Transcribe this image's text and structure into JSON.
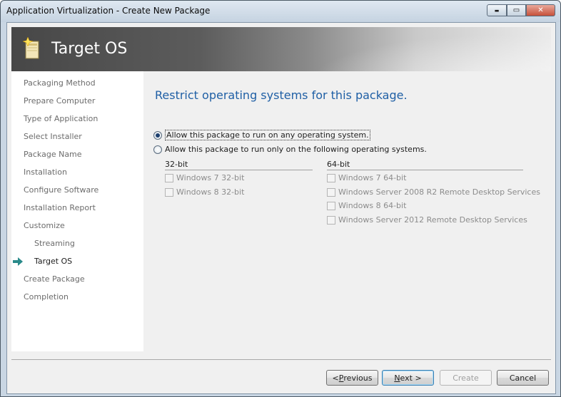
{
  "window": {
    "title": "Application Virtualization - Create New Package",
    "controls": {
      "minimize": "▬",
      "maximize": "▭",
      "close": "✕"
    }
  },
  "banner": {
    "title": "Target OS",
    "icon": "package-wizard-icon"
  },
  "nav": {
    "items": [
      {
        "label": "Packaging Method"
      },
      {
        "label": "Prepare Computer"
      },
      {
        "label": "Type of Application"
      },
      {
        "label": "Select Installer"
      },
      {
        "label": "Package Name"
      },
      {
        "label": "Installation"
      },
      {
        "label": "Configure Software"
      },
      {
        "label": "Installation Report"
      },
      {
        "label": "Customize"
      },
      {
        "label": "Streaming"
      },
      {
        "label": "Target OS"
      },
      {
        "label": "Create Package"
      },
      {
        "label": "Completion"
      }
    ],
    "current": "Target OS"
  },
  "main": {
    "heading": "Restrict operating systems for this package.",
    "options": [
      {
        "label": "Allow this package to run on any operating system.",
        "selected": true
      },
      {
        "label": "Allow this package to run only on the following operating systems.",
        "selected": false
      }
    ],
    "groups": {
      "bit32": {
        "title": "32-bit",
        "items": [
          "Windows 7 32-bit",
          "Windows 8 32-bit"
        ]
      },
      "bit64": {
        "title": "64-bit",
        "items": [
          "Windows 7 64-bit",
          "Windows Server 2008 R2 Remote Desktop Services",
          "Windows 8 64-bit",
          "Windows Server 2012 Remote Desktop Services"
        ]
      }
    }
  },
  "footer": {
    "previous_prefix": "<",
    "previous_access": "P",
    "previous_rest": "revious",
    "next_access": "N",
    "next_rest": "ext >",
    "create": "Create",
    "cancel": "Cancel"
  },
  "colors": {
    "heading": "#1f5fa5",
    "nav_arrow": "#2a8a8a",
    "disabled_text": "#8c8c8c"
  }
}
